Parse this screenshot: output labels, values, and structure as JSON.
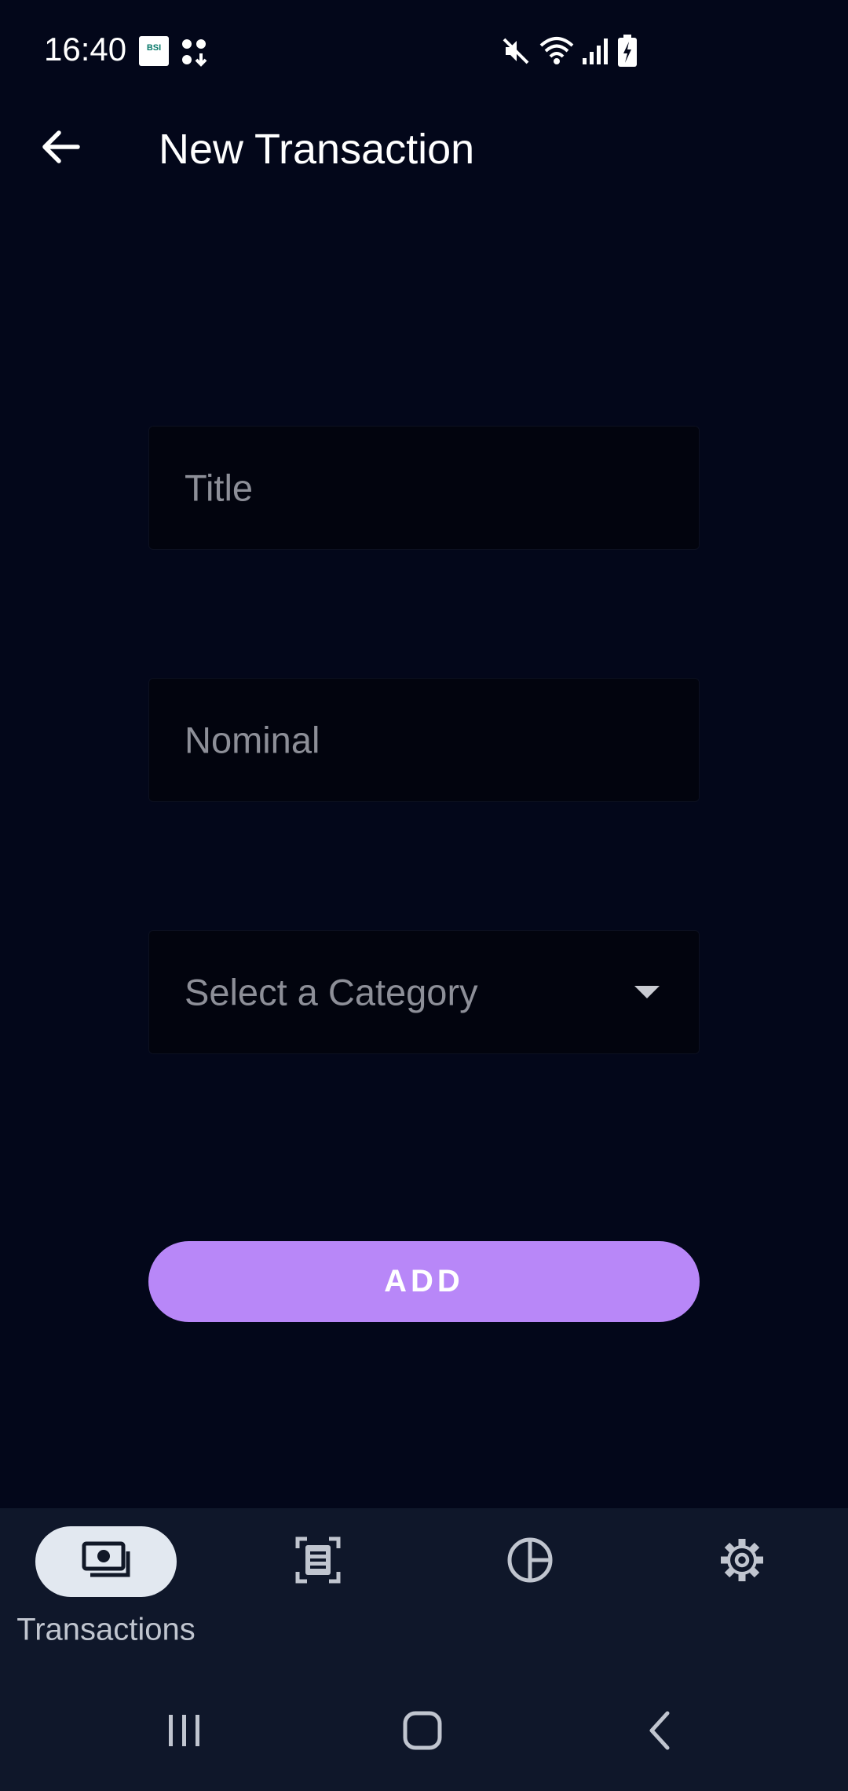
{
  "status_bar": {
    "time": "16:40",
    "bsi_label": "BSI",
    "icons": [
      "bsi-app-icon",
      "download-icon",
      "mute-icon",
      "wifi-icon",
      "signal-icon",
      "battery-charging-icon"
    ]
  },
  "app_bar": {
    "title": "New Transaction",
    "back_icon": "arrow-left-icon"
  },
  "form": {
    "title_placeholder": "Title",
    "nominal_placeholder": "Nominal",
    "category_placeholder": "Select a Category",
    "add_label": "ADD"
  },
  "bottom_nav": {
    "items": [
      {
        "label": "Transactions",
        "icon": "money-icon",
        "active": true
      },
      {
        "label": "",
        "icon": "document-scan-icon",
        "active": false
      },
      {
        "label": "",
        "icon": "pie-chart-icon",
        "active": false
      },
      {
        "label": "",
        "icon": "gear-icon",
        "active": false
      }
    ]
  },
  "system_nav": {
    "icons": [
      "recent-apps-icon",
      "home-icon",
      "back-icon"
    ]
  },
  "colors": {
    "background": "#03071a",
    "accent": "#b887f8",
    "nav_background": "#0f172a",
    "placeholder": "#8d8f98"
  }
}
